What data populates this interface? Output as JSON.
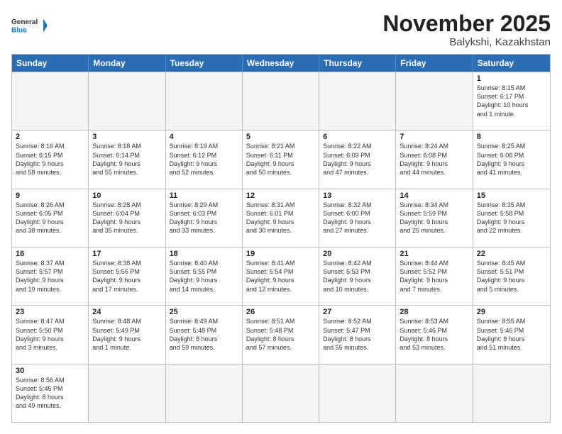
{
  "header": {
    "logo_general": "General",
    "logo_blue": "Blue",
    "month_title": "November 2025",
    "location": "Balykshi, Kazakhstan"
  },
  "weekdays": [
    "Sunday",
    "Monday",
    "Tuesday",
    "Wednesday",
    "Thursday",
    "Friday",
    "Saturday"
  ],
  "rows": [
    [
      {
        "day": "",
        "empty": true
      },
      {
        "day": "",
        "empty": true
      },
      {
        "day": "",
        "empty": true
      },
      {
        "day": "",
        "empty": true
      },
      {
        "day": "",
        "empty": true
      },
      {
        "day": "",
        "empty": true
      },
      {
        "day": "1",
        "text": "Sunrise: 8:15 AM\nSunset: 6:17 PM\nDaylight: 10 hours\nand 1 minute."
      }
    ],
    [
      {
        "day": "2",
        "text": "Sunrise: 8:16 AM\nSunset: 6:15 PM\nDaylight: 9 hours\nand 58 minutes."
      },
      {
        "day": "3",
        "text": "Sunrise: 8:18 AM\nSunset: 6:14 PM\nDaylight: 9 hours\nand 55 minutes."
      },
      {
        "day": "4",
        "text": "Sunrise: 8:19 AM\nSunset: 6:12 PM\nDaylight: 9 hours\nand 52 minutes."
      },
      {
        "day": "5",
        "text": "Sunrise: 8:21 AM\nSunset: 6:11 PM\nDaylight: 9 hours\nand 50 minutes."
      },
      {
        "day": "6",
        "text": "Sunrise: 8:22 AM\nSunset: 6:09 PM\nDaylight: 9 hours\nand 47 minutes."
      },
      {
        "day": "7",
        "text": "Sunrise: 8:24 AM\nSunset: 6:08 PM\nDaylight: 9 hours\nand 44 minutes."
      },
      {
        "day": "8",
        "text": "Sunrise: 8:25 AM\nSunset: 6:06 PM\nDaylight: 9 hours\nand 41 minutes."
      }
    ],
    [
      {
        "day": "9",
        "text": "Sunrise: 8:26 AM\nSunset: 6:05 PM\nDaylight: 9 hours\nand 38 minutes."
      },
      {
        "day": "10",
        "text": "Sunrise: 8:28 AM\nSunset: 6:04 PM\nDaylight: 9 hours\nand 35 minutes."
      },
      {
        "day": "11",
        "text": "Sunrise: 8:29 AM\nSunset: 6:03 PM\nDaylight: 9 hours\nand 33 minutes."
      },
      {
        "day": "12",
        "text": "Sunrise: 8:31 AM\nSunset: 6:01 PM\nDaylight: 9 hours\nand 30 minutes."
      },
      {
        "day": "13",
        "text": "Sunrise: 8:32 AM\nSunset: 6:00 PM\nDaylight: 9 hours\nand 27 minutes."
      },
      {
        "day": "14",
        "text": "Sunrise: 8:34 AM\nSunset: 5:59 PM\nDaylight: 9 hours\nand 25 minutes."
      },
      {
        "day": "15",
        "text": "Sunrise: 8:35 AM\nSunset: 5:58 PM\nDaylight: 9 hours\nand 22 minutes."
      }
    ],
    [
      {
        "day": "16",
        "text": "Sunrise: 8:37 AM\nSunset: 5:57 PM\nDaylight: 9 hours\nand 19 minutes."
      },
      {
        "day": "17",
        "text": "Sunrise: 8:38 AM\nSunset: 5:56 PM\nDaylight: 9 hours\nand 17 minutes."
      },
      {
        "day": "18",
        "text": "Sunrise: 8:40 AM\nSunset: 5:55 PM\nDaylight: 9 hours\nand 14 minutes."
      },
      {
        "day": "19",
        "text": "Sunrise: 8:41 AM\nSunset: 5:54 PM\nDaylight: 9 hours\nand 12 minutes."
      },
      {
        "day": "20",
        "text": "Sunrise: 8:42 AM\nSunset: 5:53 PM\nDaylight: 9 hours\nand 10 minutes."
      },
      {
        "day": "21",
        "text": "Sunrise: 8:44 AM\nSunset: 5:52 PM\nDaylight: 9 hours\nand 7 minutes."
      },
      {
        "day": "22",
        "text": "Sunrise: 8:45 AM\nSunset: 5:51 PM\nDaylight: 9 hours\nand 5 minutes."
      }
    ],
    [
      {
        "day": "23",
        "text": "Sunrise: 8:47 AM\nSunset: 5:50 PM\nDaylight: 9 hours\nand 3 minutes."
      },
      {
        "day": "24",
        "text": "Sunrise: 8:48 AM\nSunset: 5:49 PM\nDaylight: 9 hours\nand 1 minute."
      },
      {
        "day": "25",
        "text": "Sunrise: 8:49 AM\nSunset: 5:48 PM\nDaylight: 8 hours\nand 59 minutes."
      },
      {
        "day": "26",
        "text": "Sunrise: 8:51 AM\nSunset: 5:48 PM\nDaylight: 8 hours\nand 57 minutes."
      },
      {
        "day": "27",
        "text": "Sunrise: 8:52 AM\nSunset: 5:47 PM\nDaylight: 8 hours\nand 55 minutes."
      },
      {
        "day": "28",
        "text": "Sunrise: 8:53 AM\nSunset: 5:46 PM\nDaylight: 8 hours\nand 53 minutes."
      },
      {
        "day": "29",
        "text": "Sunrise: 8:55 AM\nSunset: 5:46 PM\nDaylight: 8 hours\nand 51 minutes."
      }
    ],
    [
      {
        "day": "30",
        "text": "Sunrise: 8:56 AM\nSunset: 5:45 PM\nDaylight: 8 hours\nand 49 minutes."
      },
      {
        "day": "",
        "empty": true
      },
      {
        "day": "",
        "empty": true
      },
      {
        "day": "",
        "empty": true
      },
      {
        "day": "",
        "empty": true
      },
      {
        "day": "",
        "empty": true
      },
      {
        "day": "",
        "empty": true
      }
    ]
  ]
}
